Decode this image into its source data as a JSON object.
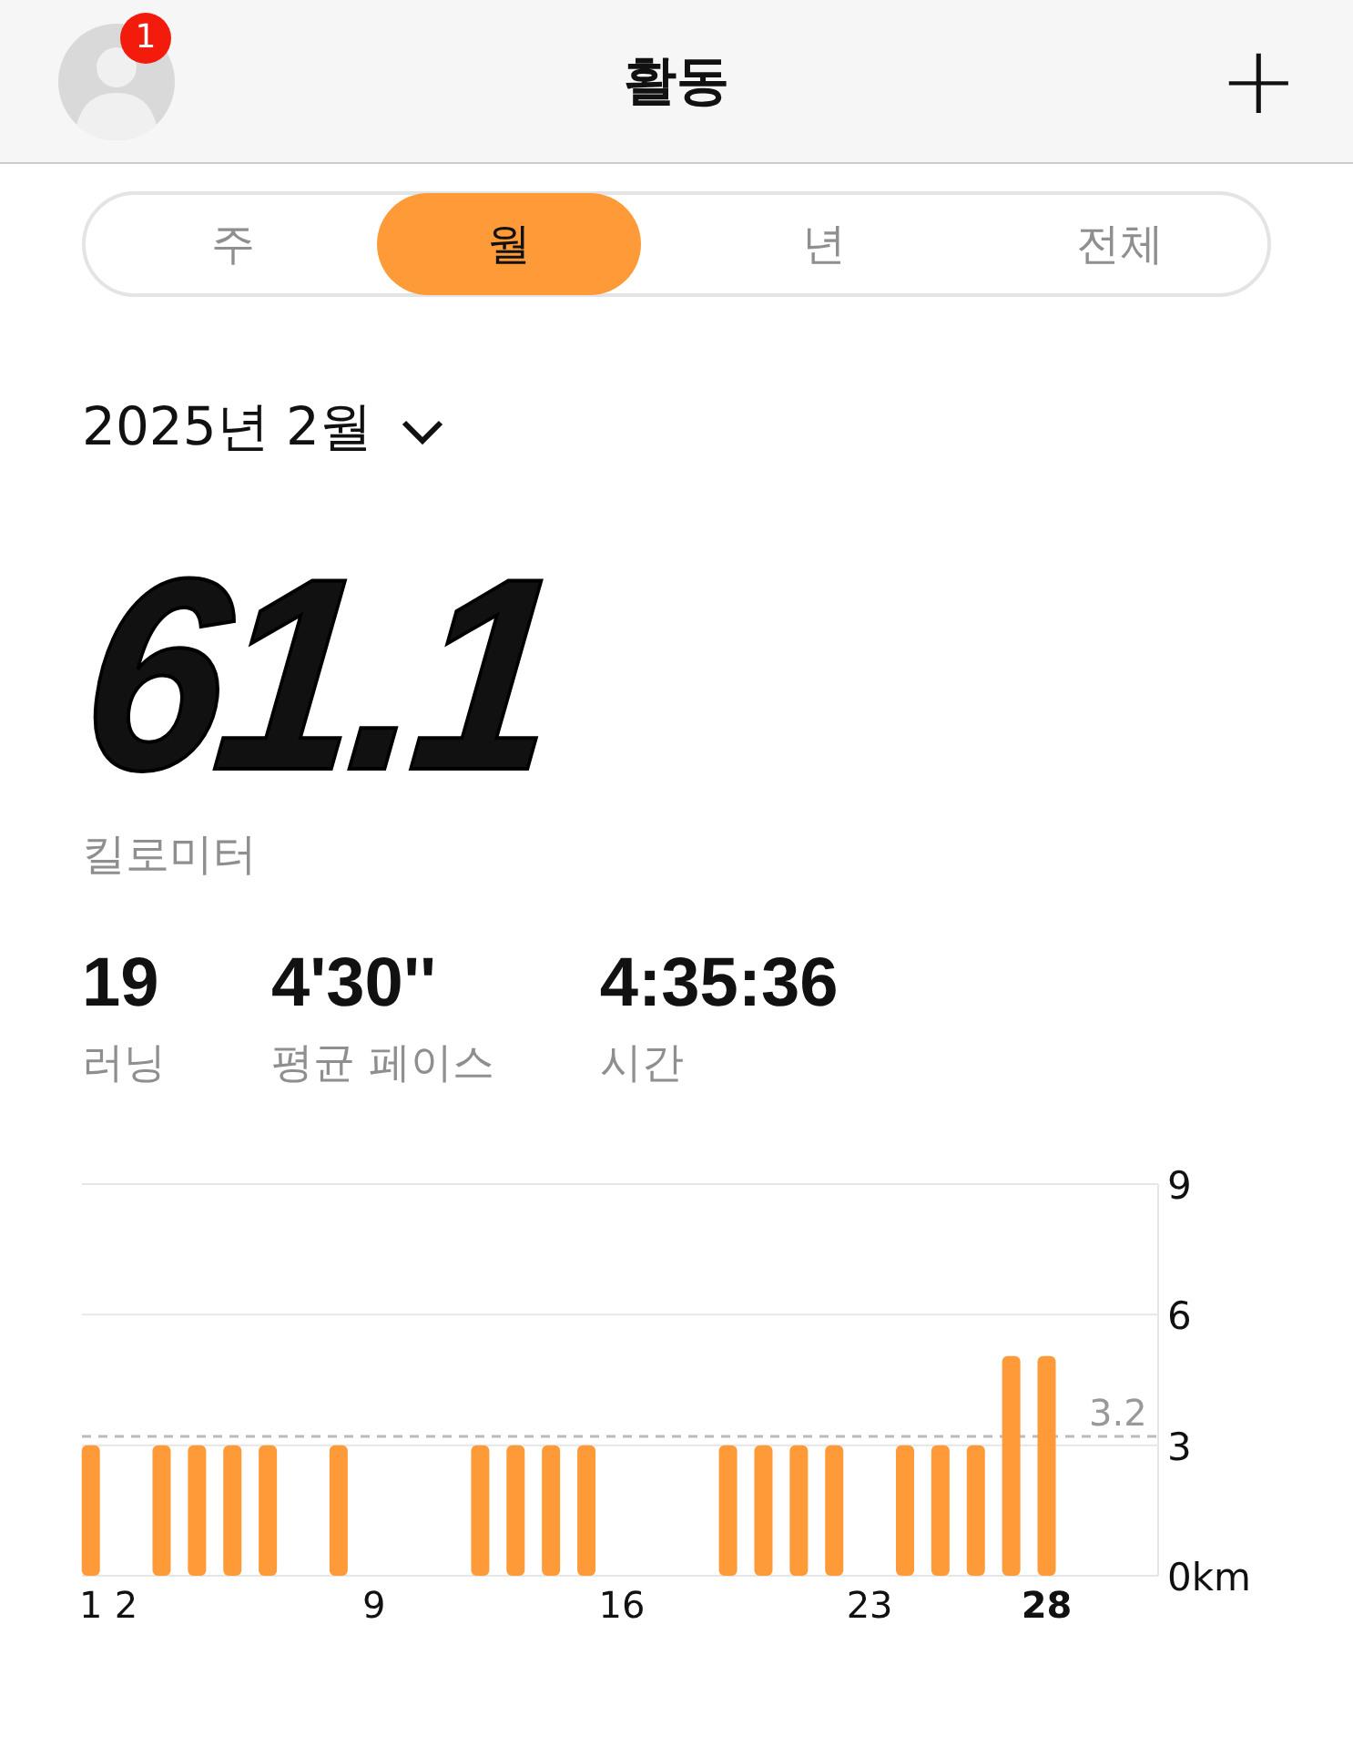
{
  "header": {
    "title": "활동",
    "notification_count": "1",
    "add_icon": "+"
  },
  "tabs": [
    {
      "label": "주",
      "selected": false
    },
    {
      "label": "월",
      "selected": true
    },
    {
      "label": "년",
      "selected": false
    },
    {
      "label": "전체",
      "selected": false
    }
  ],
  "period": "2025년 2월",
  "total": {
    "value": "61.1",
    "unit": "킬로미터"
  },
  "stats": [
    {
      "value": "19",
      "label": "러닝"
    },
    {
      "value": "4'30''",
      "label": "평균 페이스"
    },
    {
      "value": "4:35:36",
      "label": "시간"
    }
  ],
  "chart_data": {
    "type": "bar",
    "x": [
      1,
      3,
      4,
      5,
      6,
      8,
      12,
      13,
      14,
      15,
      19,
      20,
      21,
      22,
      24,
      25,
      26,
      27,
      28
    ],
    "values": [
      3.0,
      3.0,
      3.0,
      3.0,
      3.0,
      3.0,
      3.0,
      3.0,
      3.0,
      3.0,
      3.0,
      3.0,
      3.0,
      3.0,
      3.0,
      3.0,
      3.0,
      5.05,
      5.05
    ],
    "xlim": [
      0.75,
      31.15
    ],
    "ylim": [
      0,
      9
    ],
    "yticks": [
      {
        "value": 0,
        "label": "0km"
      },
      {
        "value": 3,
        "label": "3"
      },
      {
        "value": 6,
        "label": "6"
      },
      {
        "value": 9,
        "label": "9"
      }
    ],
    "xticks": [
      1,
      2,
      9,
      16,
      23,
      28
    ],
    "ref_lines": [
      {
        "axis": "y",
        "value": 3.2,
        "label": "3.2"
      }
    ]
  }
}
